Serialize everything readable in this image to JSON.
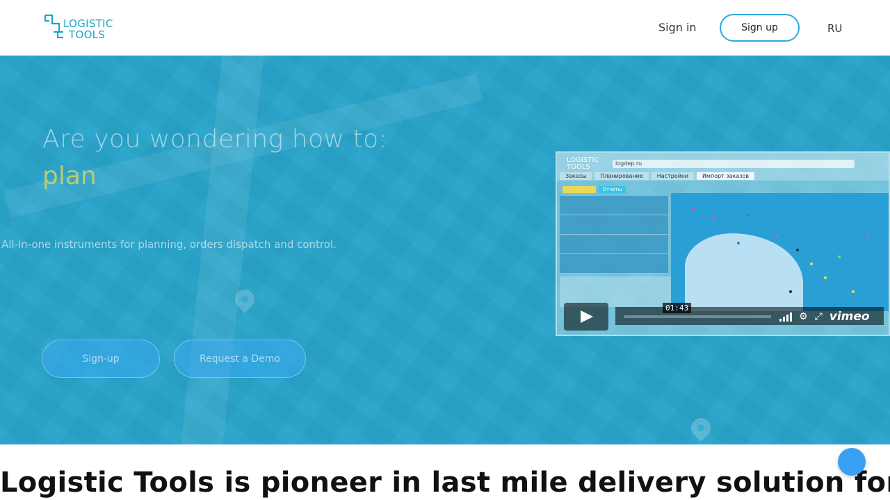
{
  "header": {
    "logo_line1": "LOGISTIC",
    "logo_line2": "TOOLS",
    "signin_label": "Sign in",
    "signup_label": "Sign up",
    "lang_label": "RU"
  },
  "hero": {
    "title": "Are you wondering how to:",
    "rotating_word": "plan",
    "subtitle": "All-in-one instruments for planning, orders dispatch and control.",
    "signup_button": "Sign-up",
    "demo_button": "Request a Demo"
  },
  "video": {
    "app_logo_line1": "LOGISTIC",
    "app_logo_line2": "TOOLS",
    "url": "logdep.ru",
    "tabs": [
      "Заказы",
      "Планирование",
      "Настройки",
      "Импорт заказов"
    ],
    "active_tab": 3,
    "chip_label": "Отчеты",
    "timecode": "01:43",
    "brand": "vimeo"
  },
  "main": {
    "headline": "Logistic Tools is pioneer in last mile delivery solution for"
  },
  "colors": {
    "accent": "#2ea8dc",
    "logo": "#1aa6c8",
    "hero_overlay": "#28aad2",
    "fab": "#3aa0f4"
  }
}
